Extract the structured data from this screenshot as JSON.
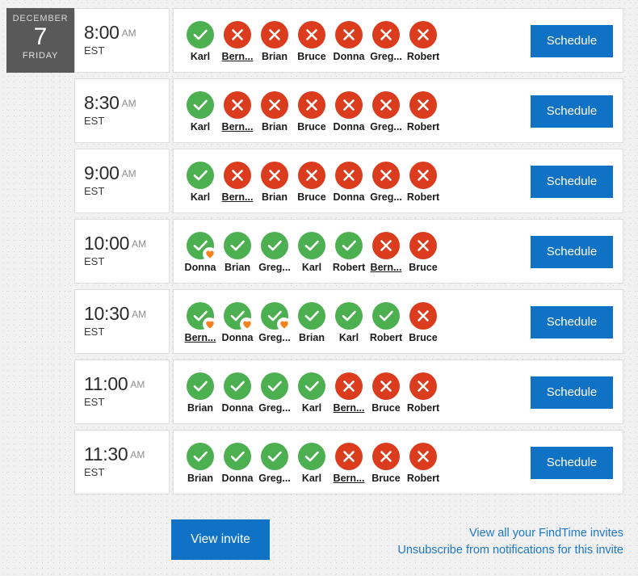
{
  "date": {
    "month": "DECEMBER",
    "day": "7",
    "weekday": "FRIDAY"
  },
  "colors": {
    "accent_blue": "#0f72c4",
    "link_blue": "#1e78c8",
    "available_green": "#4caf50",
    "unavailable_red": "#dc3c1e",
    "preferred_orange": "#f58220",
    "date_badge_gray": "#595959",
    "page_background": "#f1f1f1"
  },
  "icons": {
    "available": "check-icon",
    "unavailable": "cross-icon",
    "preferred": "heart-icon"
  },
  "schedule_label": "Schedule",
  "slots": [
    {
      "time": "8:00",
      "ampm": "AM",
      "timezone": "EST",
      "show_date": true,
      "attendees": [
        {
          "name": "Karl",
          "status": "yes",
          "preferred": false,
          "self": false
        },
        {
          "name": "Bern...",
          "status": "no",
          "preferred": false,
          "self": true
        },
        {
          "name": "Brian",
          "status": "no",
          "preferred": false,
          "self": false
        },
        {
          "name": "Bruce",
          "status": "no",
          "preferred": false,
          "self": false
        },
        {
          "name": "Donna",
          "status": "no",
          "preferred": false,
          "self": false
        },
        {
          "name": "Greg...",
          "status": "no",
          "preferred": false,
          "self": false
        },
        {
          "name": "Robert",
          "status": "no",
          "preferred": false,
          "self": false
        }
      ]
    },
    {
      "time": "8:30",
      "ampm": "AM",
      "timezone": "EST",
      "show_date": false,
      "attendees": [
        {
          "name": "Karl",
          "status": "yes",
          "preferred": false,
          "self": false
        },
        {
          "name": "Bern...",
          "status": "no",
          "preferred": false,
          "self": true
        },
        {
          "name": "Brian",
          "status": "no",
          "preferred": false,
          "self": false
        },
        {
          "name": "Bruce",
          "status": "no",
          "preferred": false,
          "self": false
        },
        {
          "name": "Donna",
          "status": "no",
          "preferred": false,
          "self": false
        },
        {
          "name": "Greg...",
          "status": "no",
          "preferred": false,
          "self": false
        },
        {
          "name": "Robert",
          "status": "no",
          "preferred": false,
          "self": false
        }
      ]
    },
    {
      "time": "9:00",
      "ampm": "AM",
      "timezone": "EST",
      "show_date": false,
      "attendees": [
        {
          "name": "Karl",
          "status": "yes",
          "preferred": false,
          "self": false
        },
        {
          "name": "Bern...",
          "status": "no",
          "preferred": false,
          "self": true
        },
        {
          "name": "Brian",
          "status": "no",
          "preferred": false,
          "self": false
        },
        {
          "name": "Bruce",
          "status": "no",
          "preferred": false,
          "self": false
        },
        {
          "name": "Donna",
          "status": "no",
          "preferred": false,
          "self": false
        },
        {
          "name": "Greg...",
          "status": "no",
          "preferred": false,
          "self": false
        },
        {
          "name": "Robert",
          "status": "no",
          "preferred": false,
          "self": false
        }
      ]
    },
    {
      "time": "10:00",
      "ampm": "AM",
      "timezone": "EST",
      "show_date": false,
      "attendees": [
        {
          "name": "Donna",
          "status": "yes",
          "preferred": true,
          "self": false
        },
        {
          "name": "Brian",
          "status": "yes",
          "preferred": false,
          "self": false
        },
        {
          "name": "Greg...",
          "status": "yes",
          "preferred": false,
          "self": false
        },
        {
          "name": "Karl",
          "status": "yes",
          "preferred": false,
          "self": false
        },
        {
          "name": "Robert",
          "status": "yes",
          "preferred": false,
          "self": false
        },
        {
          "name": "Bern...",
          "status": "no",
          "preferred": false,
          "self": true
        },
        {
          "name": "Bruce",
          "status": "no",
          "preferred": false,
          "self": false
        }
      ]
    },
    {
      "time": "10:30",
      "ampm": "AM",
      "timezone": "EST",
      "show_date": false,
      "attendees": [
        {
          "name": "Bern...",
          "status": "yes",
          "preferred": true,
          "self": true
        },
        {
          "name": "Donna",
          "status": "yes",
          "preferred": true,
          "self": false
        },
        {
          "name": "Greg...",
          "status": "yes",
          "preferred": true,
          "self": false
        },
        {
          "name": "Brian",
          "status": "yes",
          "preferred": false,
          "self": false
        },
        {
          "name": "Karl",
          "status": "yes",
          "preferred": false,
          "self": false
        },
        {
          "name": "Robert",
          "status": "yes",
          "preferred": false,
          "self": false
        },
        {
          "name": "Bruce",
          "status": "no",
          "preferred": false,
          "self": false
        }
      ]
    },
    {
      "time": "11:00",
      "ampm": "AM",
      "timezone": "EST",
      "show_date": false,
      "attendees": [
        {
          "name": "Brian",
          "status": "yes",
          "preferred": false,
          "self": false
        },
        {
          "name": "Donna",
          "status": "yes",
          "preferred": false,
          "self": false
        },
        {
          "name": "Greg...",
          "status": "yes",
          "preferred": false,
          "self": false
        },
        {
          "name": "Karl",
          "status": "yes",
          "preferred": false,
          "self": false
        },
        {
          "name": "Bern...",
          "status": "no",
          "preferred": false,
          "self": true
        },
        {
          "name": "Bruce",
          "status": "no",
          "preferred": false,
          "self": false
        },
        {
          "name": "Robert",
          "status": "no",
          "preferred": false,
          "self": false
        }
      ]
    },
    {
      "time": "11:30",
      "ampm": "AM",
      "timezone": "EST",
      "show_date": false,
      "attendees": [
        {
          "name": "Brian",
          "status": "yes",
          "preferred": false,
          "self": false
        },
        {
          "name": "Donna",
          "status": "yes",
          "preferred": false,
          "self": false
        },
        {
          "name": "Greg...",
          "status": "yes",
          "preferred": false,
          "self": false
        },
        {
          "name": "Karl",
          "status": "yes",
          "preferred": false,
          "self": false
        },
        {
          "name": "Bern...",
          "status": "no",
          "preferred": false,
          "self": true
        },
        {
          "name": "Bruce",
          "status": "no",
          "preferred": false,
          "self": false
        },
        {
          "name": "Robert",
          "status": "no",
          "preferred": false,
          "self": false
        }
      ]
    }
  ],
  "footer": {
    "view_invite_label": "View invite",
    "links": [
      "View all your FindTime invites",
      "Unsubscribe from notifications for this invite"
    ]
  }
}
